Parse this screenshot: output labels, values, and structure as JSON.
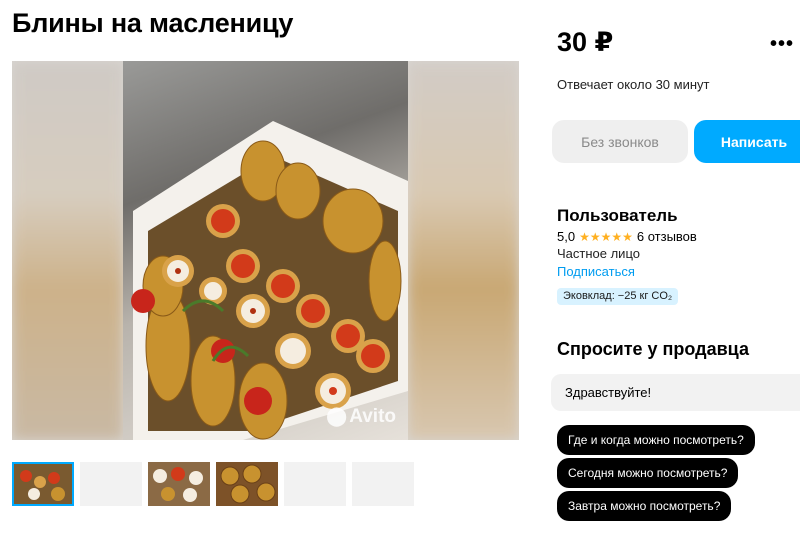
{
  "listing": {
    "title": "Блины на масленицу",
    "price": "30 ₽",
    "more_icon": "more-dots-icon",
    "reply_time": "Отвечает около 30 минут"
  },
  "actions": {
    "no_calls_label": "Без звонков",
    "write_label": "Написать"
  },
  "gallery": {
    "watermark": "Avito",
    "thumbnails": [
      {
        "type": "photo",
        "active": true
      },
      {
        "type": "blank",
        "active": false
      },
      {
        "type": "photo",
        "active": false
      },
      {
        "type": "photo",
        "active": false
      },
      {
        "type": "blank",
        "active": false
      },
      {
        "type": "blank",
        "active": false
      }
    ]
  },
  "seller": {
    "name": "Пользователь",
    "rating": "5,0",
    "stars_count": 5,
    "reviews": "6 отзывов",
    "type": "Частное лицо",
    "subscribe_label": "Подписаться",
    "eco_badge": "Эковклад: −25 кг CO₂"
  },
  "ask": {
    "title": "Спросите у продавца",
    "input_value": "Здравствуйте!",
    "quick_questions": [
      "Где и когда можно посмотреть?",
      "Сегодня можно посмотреть?",
      "Завтра можно посмотреть?"
    ]
  },
  "colors": {
    "accent": "#00aaff",
    "star": "#ffb021",
    "link": "#009cf0"
  }
}
